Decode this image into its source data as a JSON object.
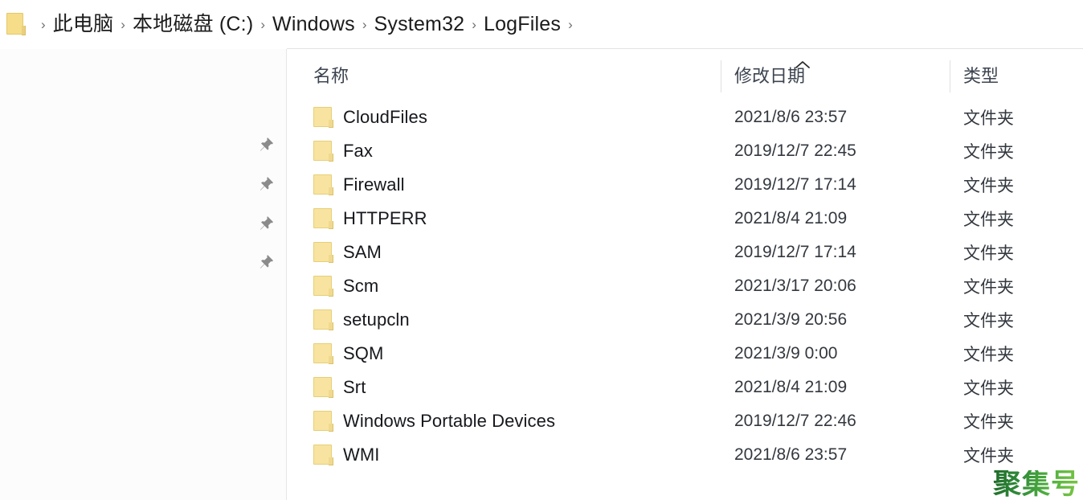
{
  "breadcrumb": {
    "folder_icon": "folder-icon",
    "separator": "›",
    "segments": [
      {
        "label": "此电脑"
      },
      {
        "label": "本地磁盘 (C:)"
      },
      {
        "label": "Windows"
      },
      {
        "label": "System32"
      },
      {
        "label": "LogFiles"
      }
    ]
  },
  "nav_pane": {
    "pins": [
      {
        "icon": "pin-icon"
      },
      {
        "icon": "pin-icon"
      },
      {
        "icon": "pin-icon"
      },
      {
        "icon": "pin-icon"
      }
    ]
  },
  "file_list": {
    "columns": [
      {
        "key": "name",
        "label": "名称",
        "sorted": true,
        "sort_direction": "ascending",
        "sort_icon": "chevron-up-icon"
      },
      {
        "key": "modified",
        "label": "修改日期"
      },
      {
        "key": "type",
        "label": "类型"
      }
    ],
    "rows": [
      {
        "icon": "folder-icon",
        "name": "CloudFiles",
        "modified": "2021/8/6 23:57",
        "type": "文件夹"
      },
      {
        "icon": "folder-icon",
        "name": "Fax",
        "modified": "2019/12/7 22:45",
        "type": "文件夹"
      },
      {
        "icon": "folder-icon",
        "name": "Firewall",
        "modified": "2019/12/7 17:14",
        "type": "文件夹"
      },
      {
        "icon": "folder-icon",
        "name": "HTTPERR",
        "modified": "2021/8/4 21:09",
        "type": "文件夹"
      },
      {
        "icon": "folder-icon",
        "name": "SAM",
        "modified": "2019/12/7 17:14",
        "type": "文件夹"
      },
      {
        "icon": "folder-icon",
        "name": "Scm",
        "modified": "2021/3/17 20:06",
        "type": "文件夹"
      },
      {
        "icon": "folder-icon",
        "name": "setupcln",
        "modified": "2021/3/9 20:56",
        "type": "文件夹"
      },
      {
        "icon": "folder-icon",
        "name": "SQM",
        "modified": "2021/3/9 0:00",
        "type": "文件夹"
      },
      {
        "icon": "folder-icon",
        "name": "Srt",
        "modified": "2021/8/4 21:09",
        "type": "文件夹"
      },
      {
        "icon": "folder-icon",
        "name": "Windows Portable Devices",
        "modified": "2019/12/7 22:46",
        "type": "文件夹"
      },
      {
        "icon": "folder-icon",
        "name": "WMI",
        "modified": "2021/8/6 23:57",
        "type": "文件夹"
      }
    ]
  },
  "watermark": {
    "text": "聚集号"
  },
  "colors": {
    "folder_fill": "#f8e4a0",
    "folder_stroke": "#e6cf78",
    "text_primary": "#16181d",
    "text_secondary": "#33383f",
    "header_text": "#3d4450",
    "divider": "#e2e2e2",
    "nav_background": "#fcfcfc",
    "watermark_start": "#1f6b2a",
    "watermark_end": "#7ec944"
  }
}
